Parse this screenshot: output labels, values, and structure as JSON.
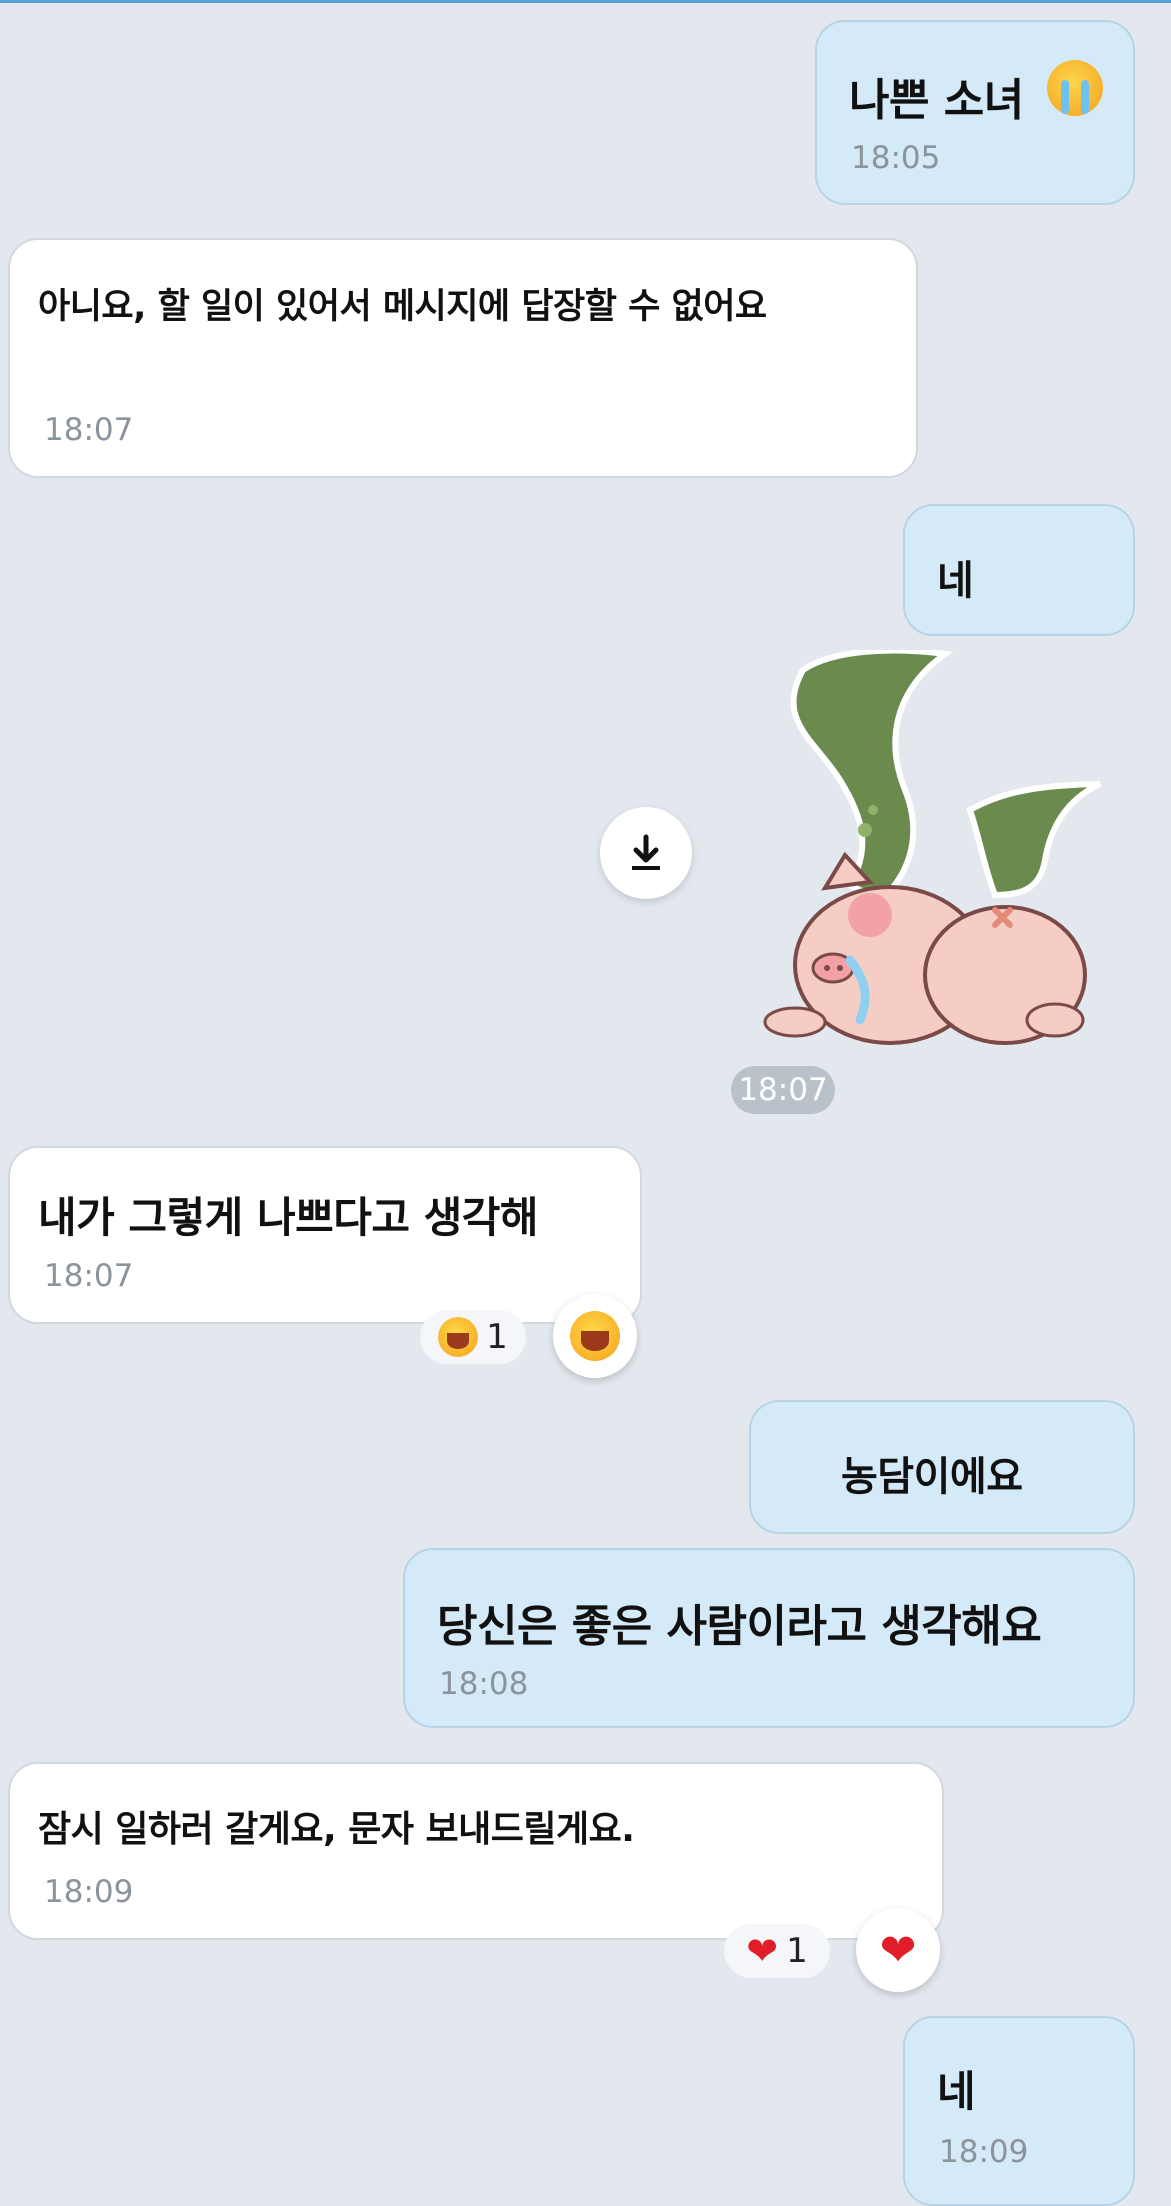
{
  "messages": [
    {
      "id": "m1",
      "dir": "out",
      "text": "나쁜 소녀",
      "emoji": "crying-face-icon",
      "time": "18:05"
    },
    {
      "id": "m2",
      "dir": "in",
      "text": "아니요, 할 일이 있어서 메시지에 답장할 수 없어요",
      "time": "18:07"
    },
    {
      "id": "m3",
      "dir": "out",
      "text": "네"
    },
    {
      "id": "m4",
      "dir": "out",
      "type": "sticker",
      "sticker": "crying-pig-sticker",
      "time": "18:07"
    },
    {
      "id": "m5",
      "dir": "in",
      "text": "내가 그렇게 나쁘다고 생각해",
      "time": "18:07",
      "reaction": {
        "emoji": "laughing-face-icon",
        "count": "1"
      }
    },
    {
      "id": "m6",
      "dir": "out",
      "text": "농담이에요"
    },
    {
      "id": "m7",
      "dir": "out",
      "text": "당신은 좋은 사람이라고 생각해요",
      "time": "18:08"
    },
    {
      "id": "m8",
      "dir": "in",
      "text": "잠시 일하러 갈게요, 문자 보내드릴게요.",
      "time": "18:09",
      "reaction": {
        "emoji": "heart-icon",
        "count": "1"
      }
    },
    {
      "id": "m9",
      "dir": "out",
      "text": "네",
      "time": "18:09"
    }
  ],
  "colors": {
    "outgoing_bubble": "#d5eaf8",
    "incoming_bubble": "#ffffff",
    "background": "#e3e8ef",
    "heart": "#e11d2a"
  }
}
